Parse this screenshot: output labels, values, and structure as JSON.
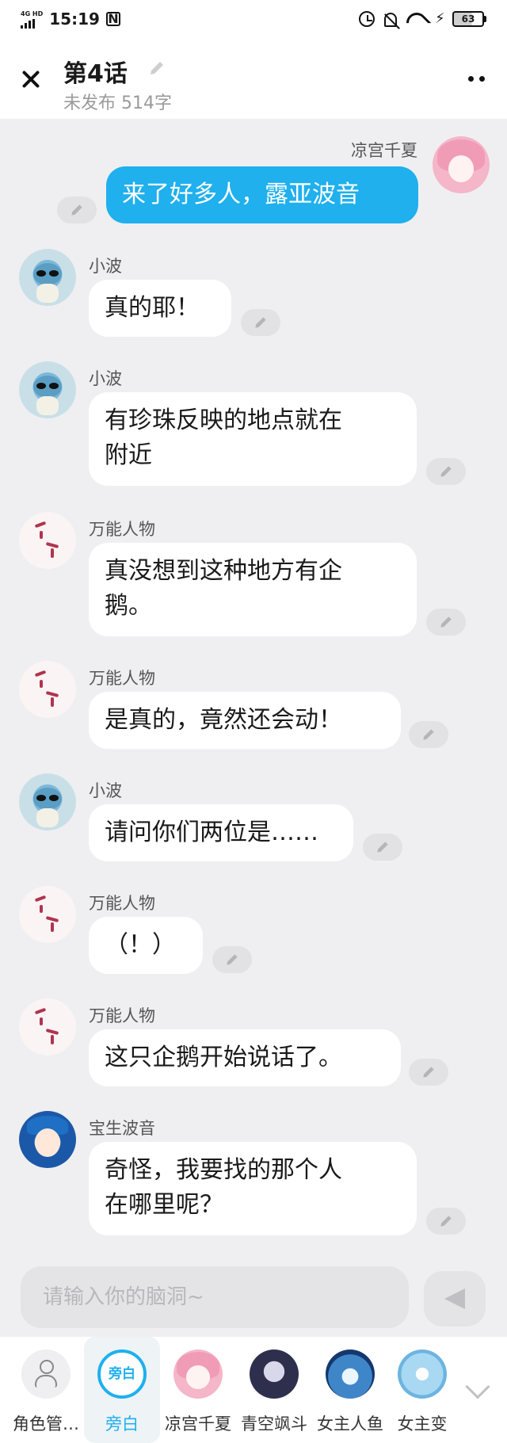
{
  "status_bar": {
    "network": "4G HD",
    "time": "15:19",
    "notif_glyph": "N",
    "battery": "63"
  },
  "header": {
    "title": "第4话",
    "subtitle": "未发布 514字"
  },
  "messages": [
    {
      "speaker": "凉宫千夏",
      "text": "来了好多人，露亚波音",
      "self": true
    },
    {
      "speaker": "小波",
      "text": "真的耶！"
    },
    {
      "speaker": "小波",
      "line1": "有珍珠反映的地点就在",
      "line2": "附近"
    },
    {
      "speaker": "万能人物",
      "line1": "真没想到这种地方有企",
      "line2": "鹅。"
    },
    {
      "speaker": "万能人物",
      "text": "是真的，竟然还会动！"
    },
    {
      "speaker": "小波",
      "text": "请问你们两位是……"
    },
    {
      "speaker": "万能人物",
      "text": "（！）"
    },
    {
      "speaker": "万能人物",
      "text": "这只企鹅开始说话了。"
    },
    {
      "speaker": "宝生波音",
      "line1": "奇怪，我要找的那个人",
      "line2": "在哪里呢？"
    }
  ],
  "input": {
    "placeholder": "请输入你的脑洞~"
  },
  "roles": [
    {
      "label": "角色管…",
      "icon": "role-manage-icon"
    },
    {
      "label": "旁白",
      "badge": "旁白",
      "icon": "narrator-icon",
      "active": true
    },
    {
      "label": "凉宫千夏",
      "icon": "avatar"
    },
    {
      "label": "青空飒斗",
      "icon": "avatar"
    },
    {
      "label": "女主人鱼",
      "icon": "avatar"
    },
    {
      "label": "女主变",
      "icon": "avatar"
    }
  ],
  "colors": {
    "accent": "#1fb0ed",
    "background": "#efeff1",
    "bubble": "#ffffff"
  }
}
